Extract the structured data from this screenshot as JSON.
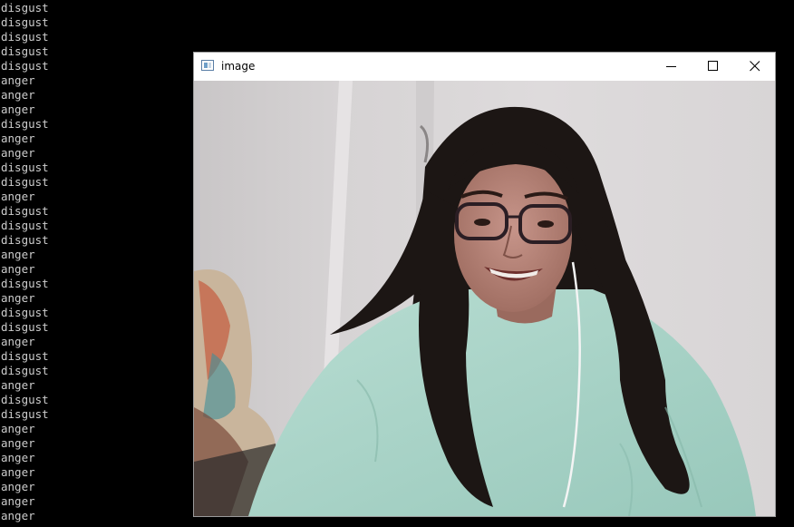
{
  "console": {
    "lines": [
      "disgust",
      "disgust",
      "disgust",
      "disgust",
      "disgust",
      "anger",
      "anger",
      "anger",
      "disgust",
      "anger",
      "anger",
      "disgust",
      "disgust",
      "anger",
      "disgust",
      "disgust",
      "disgust",
      "anger",
      "anger",
      "disgust",
      "anger",
      "disgust",
      "disgust",
      "anger",
      "disgust",
      "disgust",
      "anger",
      "disgust",
      "disgust",
      "anger",
      "anger",
      "anger",
      "anger",
      "anger",
      "anger",
      "anger"
    ]
  },
  "window": {
    "title": "image",
    "icon": "opencv-window-icon",
    "buttons": {
      "minimize": "minimize-icon",
      "maximize": "maximize-icon",
      "close": "close-icon"
    }
  },
  "image": {
    "content": "webcam-frame",
    "colors": {
      "wall": "#d9d6d7",
      "hair": "#1c1614",
      "shirt": "#a7d4c7",
      "skin": "#b88474"
    }
  }
}
